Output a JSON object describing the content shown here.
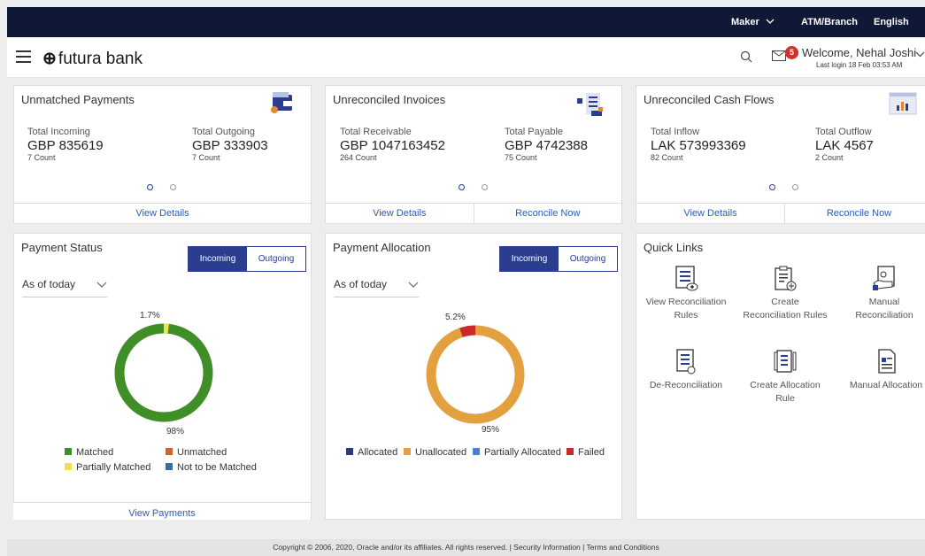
{
  "topbar": {
    "role": "Maker",
    "branch": "ATM/Branch",
    "language": "English"
  },
  "header": {
    "brand": "futura bank",
    "notifications_count": "5",
    "welcome": "Welcome, Nehal Joshi",
    "last_login": "Last login 18 Feb 03:53 AM"
  },
  "cards": {
    "unmatched": {
      "title": "Unmatched Payments",
      "left": {
        "label": "Total Incoming",
        "value": "GBP 835619",
        "count": "7 Count"
      },
      "right": {
        "label": "Total Outgoing",
        "value": "GBP 333903",
        "count": "7 Count"
      },
      "view_details": "View Details"
    },
    "invoices": {
      "title": "Unreconciled Invoices",
      "left": {
        "label": "Total Receivable",
        "value": "GBP 1047163452",
        "count": "264 Count"
      },
      "right": {
        "label": "Total Payable",
        "value": "GBP 4742388",
        "count": "75 Count"
      },
      "view_details": "View Details",
      "reconcile_now": "Reconcile Now"
    },
    "cashflows": {
      "title": "Unreconciled Cash Flows",
      "left": {
        "label": "Total Inflow",
        "value": "LAK 573993369",
        "count": "82 Count"
      },
      "right": {
        "label": "Total Outflow",
        "value": "LAK 4567",
        "count": "2 Count"
      },
      "view_details": "View Details",
      "reconcile_now": "Reconcile Now"
    }
  },
  "payment_status": {
    "title": "Payment Status",
    "incoming": "Incoming",
    "outgoing": "Outgoing",
    "as_of": "As of today",
    "top_pct": "1.7%",
    "bottom_pct": "98%",
    "legend": [
      "Matched",
      "Unmatched",
      "Partially Matched",
      "Not to be Matched"
    ],
    "view_payments": "View Payments",
    "colors": {
      "matched": "#3f8e27",
      "unmatched": "#d2602a",
      "partially": "#f5e04c",
      "not_matched": "#3c6d9e"
    }
  },
  "payment_allocation": {
    "title": "Payment Allocation",
    "incoming": "Incoming",
    "outgoing": "Outgoing",
    "as_of": "As of today",
    "top_pct": "5.2%",
    "bottom_pct": "95%",
    "legend": [
      "Allocated",
      "Unallocated",
      "Partially Allocated",
      "Failed"
    ],
    "colors": {
      "allocated": "#2a3a7a",
      "unallocated": "#e3a03f",
      "partially": "#4a7fd4",
      "failed": "#c82a2a"
    }
  },
  "quick_links": {
    "title": "Quick Links",
    "items": [
      {
        "label": "View Reconciliation Rules",
        "icon": "view-rules-icon"
      },
      {
        "label": "Create Reconciliation Rules",
        "icon": "create-rules-icon"
      },
      {
        "label": "Manual Reconciliation",
        "icon": "manual-reconciliation-icon"
      },
      {
        "label": "De-Reconciliation",
        "icon": "de-reconciliation-icon"
      },
      {
        "label": "Create Allocation Rule",
        "icon": "create-allocation-icon"
      },
      {
        "label": "Manual Allocation",
        "icon": "manual-allocation-icon"
      }
    ]
  },
  "footer": {
    "text": "Copyright © 2006, 2020, Oracle and/or its affiliates. All rights reserved. | Security Information | Terms and Conditions"
  }
}
